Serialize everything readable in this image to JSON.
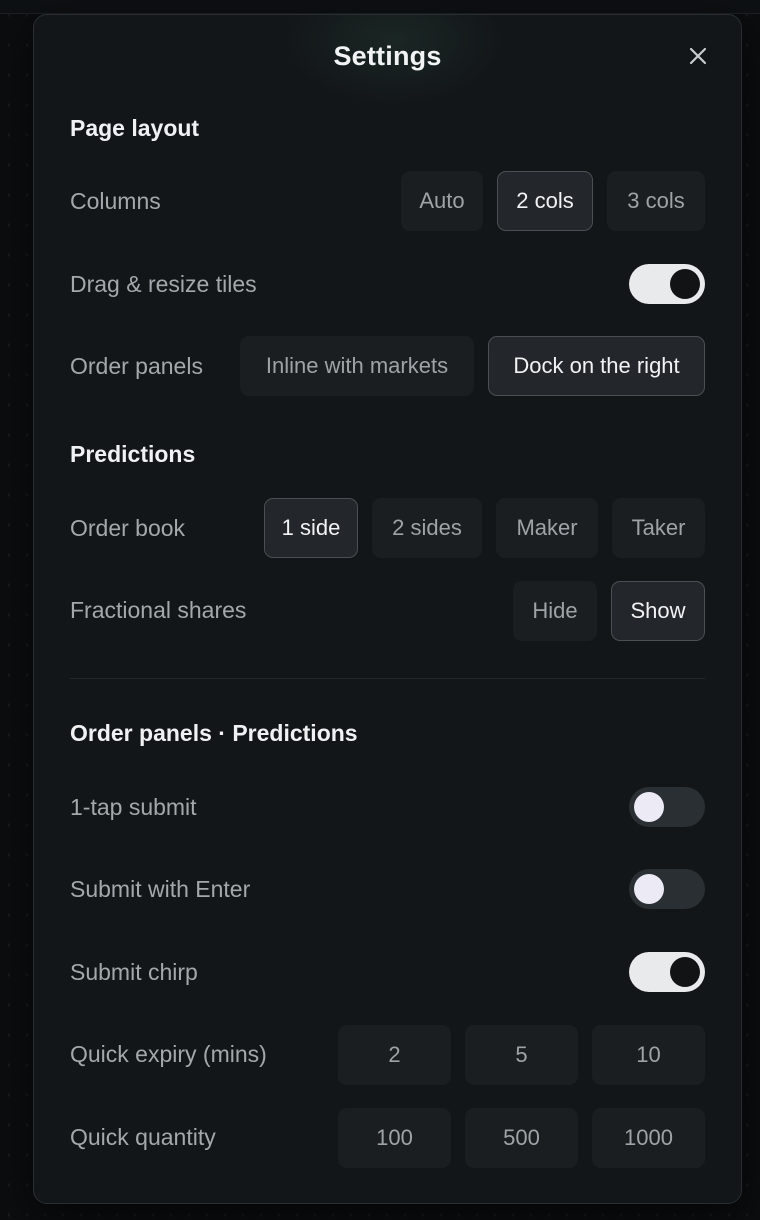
{
  "modal": {
    "title": "Settings"
  },
  "page_layout": {
    "section_title": "Page layout",
    "columns": {
      "label": "Columns",
      "options": [
        "Auto",
        "2 cols",
        "3 cols"
      ],
      "selected": "2 cols"
    },
    "drag_resize": {
      "label": "Drag & resize tiles",
      "enabled": true
    },
    "order_panels": {
      "label": "Order panels",
      "options": [
        "Inline with markets",
        "Dock on the right"
      ],
      "selected": "Dock on the right"
    }
  },
  "predictions": {
    "section_title": "Predictions",
    "order_book": {
      "label": "Order book",
      "options": [
        "1 side",
        "2 sides",
        "Maker",
        "Taker"
      ],
      "selected": "1 side"
    },
    "fractional_shares": {
      "label": "Fractional shares",
      "options": [
        "Hide",
        "Show"
      ],
      "selected": "Show"
    }
  },
  "order_panels_predictions": {
    "section_title": "Order panels · Predictions",
    "one_tap_submit": {
      "label": "1-tap submit",
      "enabled": false
    },
    "submit_with_enter": {
      "label": "Submit with Enter",
      "enabled": false
    },
    "submit_chirp": {
      "label": "Submit chirp",
      "enabled": true
    },
    "quick_expiry": {
      "label": "Quick expiry (mins)",
      "options": [
        "2",
        "5",
        "10"
      ]
    },
    "quick_quantity": {
      "label": "Quick quantity",
      "options": [
        "100",
        "500",
        "1000"
      ]
    }
  },
  "colors": {
    "modal_bg": "#131618",
    "selected_border": "#4a4f54",
    "toggle_on": "#e9eaec",
    "toggle_off": "#2a2f33"
  },
  "icons": {
    "close": "close-icon"
  }
}
